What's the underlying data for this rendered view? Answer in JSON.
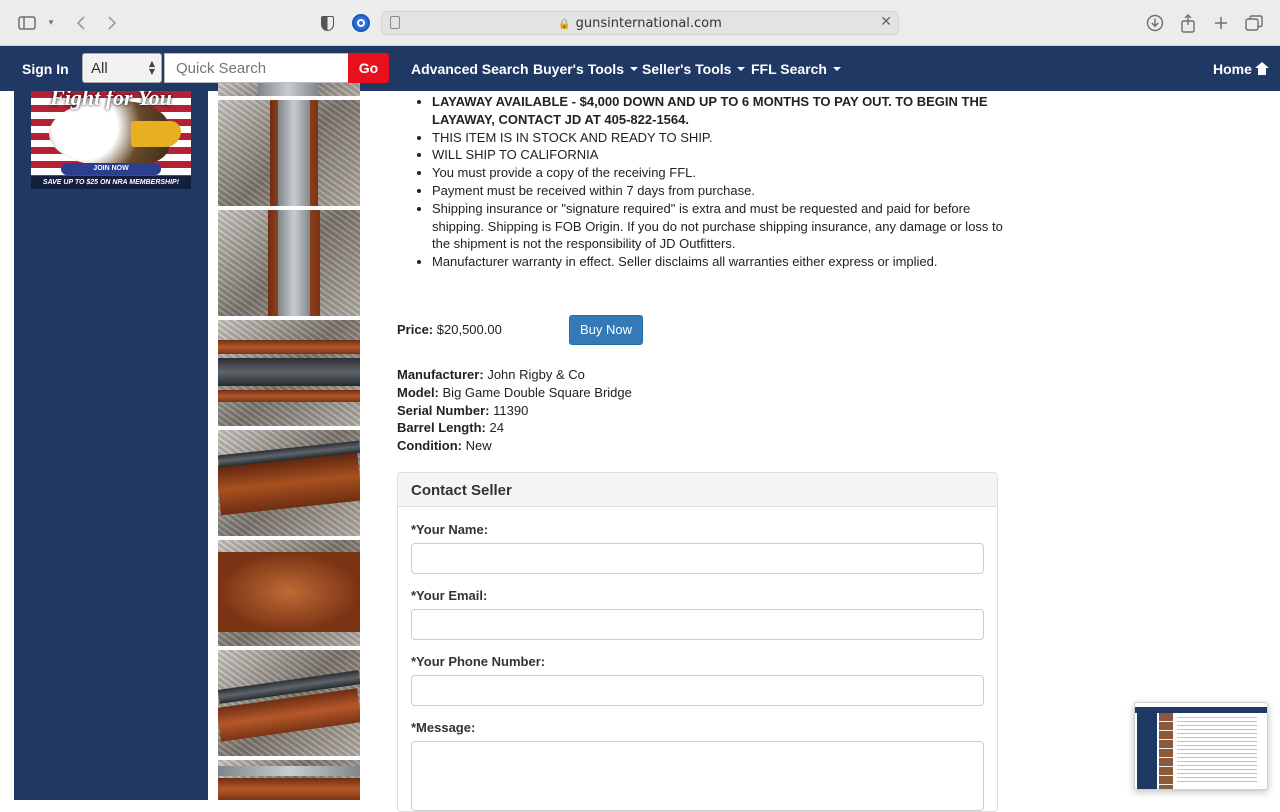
{
  "browser": {
    "url": "gunsinternational.com"
  },
  "nav": {
    "sign_in": "Sign In",
    "category_select": "All",
    "search_placeholder": "Quick Search",
    "go": "Go",
    "links": {
      "advanced_search": "Advanced Search",
      "buyers_tools": "Buyer's Tools",
      "sellers_tools": "Seller's Tools",
      "ffl_search": "FFL Search",
      "home": "Home"
    }
  },
  "ad": {
    "title": "Fight for You",
    "join_button": "JOIN NOW",
    "footer": "SAVE UP TO $25 ON NRA MEMBERSHIP!"
  },
  "listing": {
    "bullets": [
      "LAYAWAY AVAILABLE - $4,000 DOWN AND UP TO 6 MONTHS TO PAY OUT.  TO BEGIN THE LAYAWAY, CONTACT JD AT 405-822-1564.",
      "THIS ITEM IS IN STOCK AND READY TO SHIP.",
      "WILL SHIP TO CALIFORNIA",
      "You must provide a copy of the receiving FFL.",
      "Payment must be received within 7 days from purchase.",
      "Shipping insurance or \"signature required\" is extra and must be requested and paid for before shipping. Shipping is FOB Origin.  If you do not purchase shipping insurance, any damage or loss to the shipment is not the responsibility of JD Outfitters.",
      "Manufacturer warranty in effect. Seller disclaims all warranties either express or implied."
    ],
    "price_label": "Price:",
    "price_value": "$20,500.00",
    "buy_now": "Buy Now",
    "specs": {
      "manufacturer_label": "Manufacturer:",
      "manufacturer": "John Rigby & Co",
      "model_label": "Model:",
      "model": "Big Game Double Square Bridge",
      "serial_label": "Serial Number:",
      "serial": "11390",
      "barrel_label": "Barrel Length:",
      "barrel": "24",
      "condition_label": "Condition:",
      "condition": "New"
    }
  },
  "contact": {
    "heading": "Contact Seller",
    "name_label": "*Your Name:",
    "email_label": "*Your Email:",
    "phone_label": "*Your Phone Number:",
    "message_label": "*Message:"
  }
}
